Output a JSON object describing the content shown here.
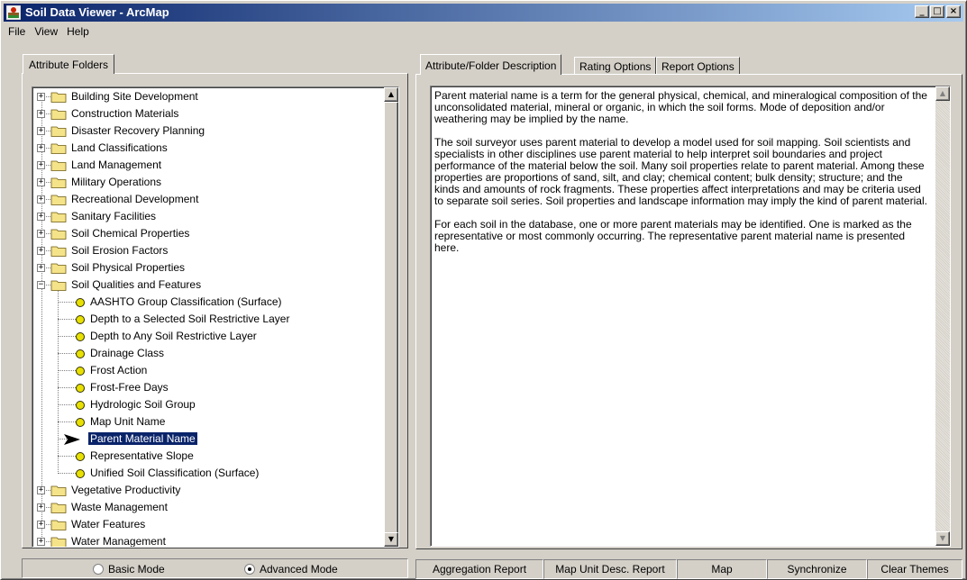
{
  "window": {
    "title": "Soil Data Viewer - ArcMap",
    "controls": {
      "minimize": "_",
      "maximize": "□",
      "close": "×"
    }
  },
  "menu": [
    "File",
    "View",
    "Help"
  ],
  "left_tab": "Attribute Folders",
  "tree": {
    "folders_top": [
      "Building Site Development",
      "Construction Materials",
      "Disaster Recovery Planning",
      "Land Classifications",
      "Land Management",
      "Military Operations",
      "Recreational Development",
      "Sanitary Facilities",
      "Soil Chemical Properties",
      "Soil Erosion Factors",
      "Soil Physical Properties"
    ],
    "expanded_folder": "Soil Qualities and Features",
    "attributes": [
      "AASHTO Group Classification (Surface)",
      "Depth to a Selected Soil Restrictive Layer",
      "Depth to Any Soil Restrictive Layer",
      "Drainage Class",
      "Frost Action",
      "Frost-Free Days",
      "Hydrologic Soil Group",
      "Map Unit Name",
      "Parent Material Name",
      "Representative Slope",
      "Unified Soil Classification (Surface)"
    ],
    "selected_attribute": "Parent Material Name",
    "folders_bottom": [
      "Vegetative Productivity",
      "Waste Management",
      "Water Features",
      "Water Management"
    ]
  },
  "mode": {
    "basic": "Basic Mode",
    "advanced": "Advanced Mode",
    "selected": "advanced"
  },
  "right_tabs": [
    "Attribute/Folder Description",
    "Rating Options",
    "Report Options"
  ],
  "active_right_tab": "Attribute/Folder Description",
  "description": [
    "Parent material name is a term for the general physical, chemical, and mineralogical composition of the unconsolidated material, mineral or organic, in which the soil forms. Mode of deposition and/or weathering may be implied by the name.",
    "The soil surveyor uses parent material to develop a model used for soil mapping. Soil scientists and specialists in other disciplines use parent material to help interpret soil boundaries and project performance of the material below the soil. Many soil properties relate to parent material. Among these properties are proportions of sand, silt, and clay; chemical content; bulk density; structure; and the kinds and amounts of rock fragments. These properties affect interpretations and may be criteria used to separate soil series. Soil properties and landscape information may imply the kind of parent material.",
    "For each soil in the database, one or more parent materials may be identified. One is marked as the representative or most commonly occurring.  The representative parent material name is presented here."
  ],
  "buttons": [
    "Aggregation Report",
    "Map Unit Desc. Report",
    "Map",
    "Synchronize",
    "Clear Themes"
  ],
  "colors": {
    "title_gradient_start": "#0a246a",
    "title_gradient_end": "#a6caf0",
    "folder": "#f5e38a",
    "leaf": "#e8e000",
    "selection": "#0a246a"
  }
}
